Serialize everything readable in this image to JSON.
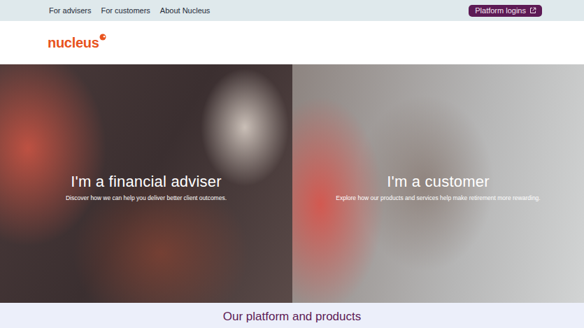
{
  "nav": {
    "links": [
      {
        "label": "For advisers"
      },
      {
        "label": "For customers"
      },
      {
        "label": "About Nucleus"
      }
    ],
    "login": {
      "label": "Platform logins"
    }
  },
  "logo": {
    "text": "nucleus"
  },
  "panels": [
    {
      "title": "I'm a financial adviser",
      "subtitle": "Discover how we can help you deliver better client outcomes."
    },
    {
      "title": "I'm a customer",
      "subtitle": "Explore how our products and services help make retirement more rewarding."
    }
  ],
  "section": {
    "heading": "Our platform and products"
  }
}
